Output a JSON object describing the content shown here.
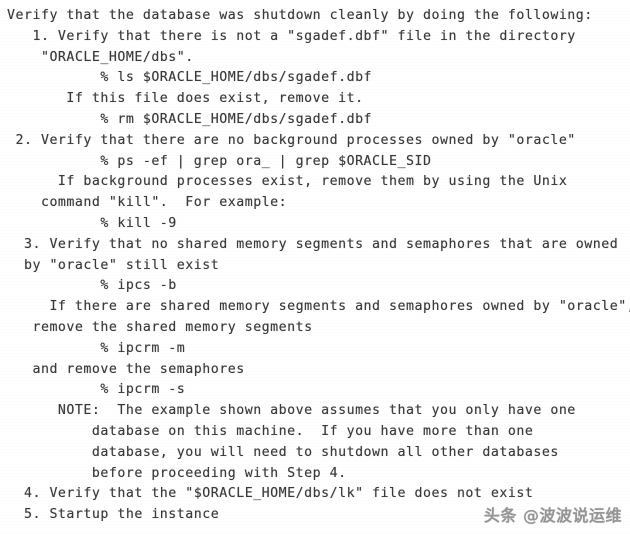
{
  "document": {
    "kind": "scanned-text-page",
    "background_color": "#ffffff",
    "text_color": "#3a3a3a",
    "lines": [
      "Verify that the database was shutdown cleanly by doing the following:",
      "   1. Verify that there is not a \"sgadef.dbf\" file in the directory",
      "    \"ORACLE_HOME/dbs\".",
      "           % ls $ORACLE_HOME/dbs/sgadef.dbf",
      "       If this file does exist, remove it.",
      "           % rm $ORACLE_HOME/dbs/sgadef.dbf",
      " 2. Verify that there are no background processes owned by \"oracle\"",
      "           % ps -ef | grep ora_ | grep $ORACLE_SID",
      "      If background processes exist, remove them by using the Unix",
      "    command \"kill\".  For example:",
      "           % kill -9",
      "  3. Verify that no shared memory segments and semaphores that are owned",
      "  by \"oracle\" still exist",
      "           % ipcs -b",
      "     If there are shared memory segments and semaphores owned by \"oracle\",",
      "   remove the shared memory segments",
      "           % ipcrm -m",
      "   and remove the semaphores",
      "           % ipcrm -s",
      "      NOTE:  The example shown above assumes that you only have one",
      "          database on this machine.  If you have more than one",
      "          database, you will need to shutdown all other databases",
      "          before proceeding with Step 4.",
      "  4. Verify that the \"$ORACLE_HOME/dbs/lk\" file does not exist",
      "  5. Startup the instance"
    ]
  },
  "watermark": {
    "text": "头条 @波波说运维",
    "color": "#8d8d8d"
  }
}
